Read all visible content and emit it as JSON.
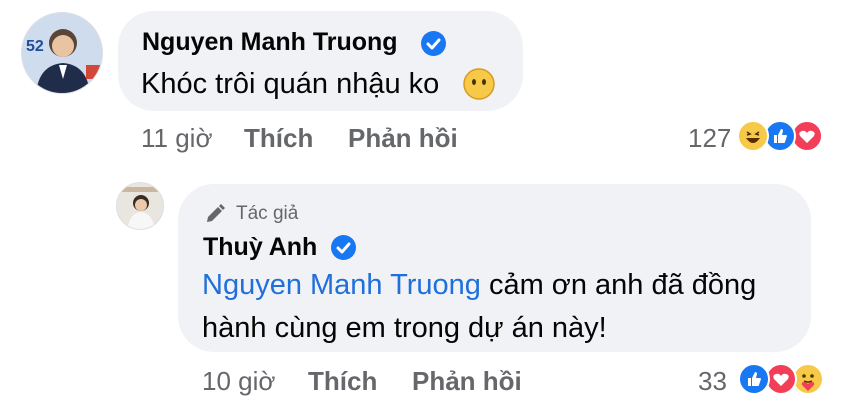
{
  "comment": {
    "author": "Nguyen Manh Truong",
    "text": "Khóc trôi quán nhậu ko",
    "time": "11 giờ",
    "like_label": "Thích",
    "reply_label": "Phản hồi",
    "reaction_count": "127",
    "reactions": [
      "haha-icon",
      "like-icon",
      "love-icon"
    ],
    "avatar_badge": "52"
  },
  "reply": {
    "badge": "Tác giả",
    "author": "Thuỳ Anh",
    "mention": "Nguyen Manh Truong",
    "text_line1": "cảm ơn anh đã đồng",
    "text_line2": "hành cùng em trong dự án này!",
    "time": "10 giờ",
    "like_label": "Thích",
    "reply_label": "Phản hồi",
    "reaction_count": "33",
    "reactions": [
      "like-icon",
      "love-icon",
      "care-icon"
    ]
  },
  "colors": {
    "bubble": "#f0f2f5",
    "link": "#216fdb",
    "meta": "#65676b",
    "verified": "#1877f2"
  }
}
